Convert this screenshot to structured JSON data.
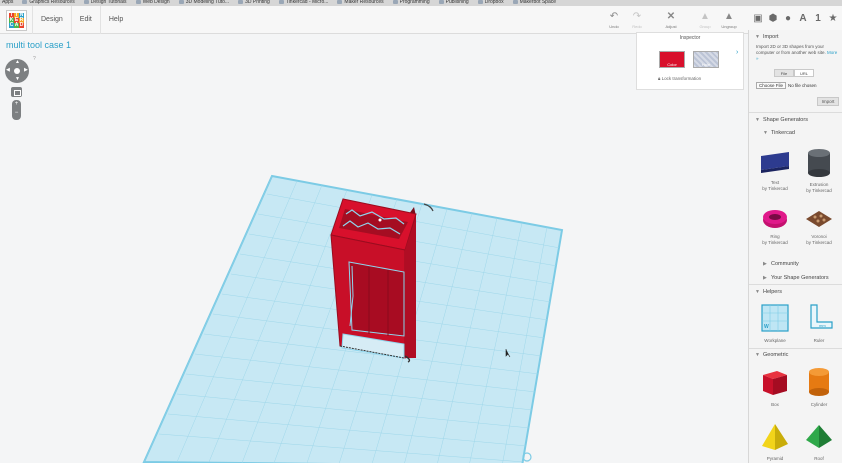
{
  "bookmarks": [
    "Apps",
    "Graphics Resources",
    "Design Tutorials",
    "Web Design",
    "3D Modeling Tuto...",
    "3D Printing",
    "Tinkercad - Micro...",
    "Maker Resources",
    "Programming",
    "Publishing",
    "Dropbox",
    "Makerbot Space"
  ],
  "logo": {
    "letters": [
      "TIN",
      "KER",
      "CAD"
    ]
  },
  "menu": {
    "design": "Design",
    "edit": "Edit",
    "help": "Help"
  },
  "toolbar": {
    "undo": "Undo",
    "redo": "Redo",
    "adjust": "Adjust",
    "group": "Group",
    "ungroup": "Ungroup"
  },
  "design": {
    "title": "multi tool case 1"
  },
  "nav": {
    "help": "?",
    "zoom_in": "+",
    "zoom_out": "−"
  },
  "inspector": {
    "title": "Inspector",
    "color_label": "Color",
    "hole_label": "Hole",
    "lock_label": "Lock transformation",
    "color_value": "#d8102c"
  },
  "panel": {
    "import": {
      "title": "Import",
      "description": "Import 2D or 3D shapes from your computer or from another web site.",
      "more": "More »",
      "tab_file": "File",
      "tab_url": "URL",
      "choose_label": "Choose File",
      "no_file": "No file chosen",
      "button": "Import"
    },
    "shape_generators": "Shape Generators",
    "tinkercad": "Tinkercad",
    "generators": [
      {
        "name": "Text",
        "by": "by Tinkercad"
      },
      {
        "name": "Extrusion",
        "by": "by Tinkercad"
      },
      {
        "name": "Ring",
        "by": "by Tinkercad"
      },
      {
        "name": "Voronoi",
        "by": "by Tinkercad"
      }
    ],
    "community": "Community",
    "your_shape_generators": "Your Shape Generators",
    "helpers": "Helpers",
    "helper_items": [
      {
        "name": "Workplane"
      },
      {
        "name": "Ruler"
      }
    ],
    "geometric": "Geometric",
    "geometric_items": [
      {
        "name": "Box"
      },
      {
        "name": "Cylinder"
      },
      {
        "name": "Pyramid"
      },
      {
        "name": "Roof"
      }
    ]
  },
  "colors": {
    "accent": "#2ba0c8",
    "shape_red": "#d8102c",
    "grid": "#bfe3f0",
    "grid_line": "#8fd0e6"
  }
}
